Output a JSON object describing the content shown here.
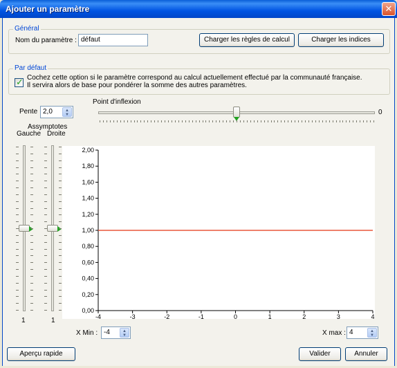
{
  "window": {
    "title": "Ajouter un paramètre",
    "close_glyph": "✕"
  },
  "general": {
    "legend": "Général",
    "name_label": "Nom du paramètre :",
    "name_value": "défaut",
    "load_rules_label": "Charger les règles de calcul",
    "load_indices_label": "Charger les indices"
  },
  "default_group": {
    "legend": "Par défaut",
    "checkbox_checked": true,
    "checkbox_text_line1": "Cochez cette option si le paramètre correspond au calcul actuellement effectué par la communauté française.",
    "checkbox_text_line2": "Il servira alors de base pour pondérer la somme des autres paramètres."
  },
  "pente": {
    "label": "Pente",
    "value": "2,0"
  },
  "inflexion": {
    "label": "Point d'inflexion",
    "value_label": "0",
    "slider_fraction": 0.5
  },
  "asymptotes": {
    "title": "Assymptotes",
    "left_label": "Gauche",
    "right_label": "Droite",
    "left_value": "1",
    "right_value": "1",
    "left_slider_fraction": 0.5,
    "right_slider_fraction": 0.5
  },
  "range": {
    "xmin_label": "X Min :",
    "xmin_value": "-4",
    "xmax_label": "X max :",
    "xmax_value": "4"
  },
  "buttons": {
    "preview_label": "Aperçu rapide",
    "validate_label": "Valider",
    "cancel_label": "Annuler"
  },
  "colors": {
    "series_line": "#e8563a",
    "legend_blue": "#0046d5",
    "title_bar": "#0054e3"
  },
  "chart_data": {
    "type": "line",
    "x": [
      -4,
      -3,
      -2,
      -1,
      0,
      1,
      2,
      3,
      4
    ],
    "series": [
      {
        "values": [
          1.0,
          1.0,
          1.0,
          1.0,
          1.0,
          1.0,
          1.0,
          1.0,
          1.0
        ]
      }
    ],
    "xticks": [
      "-4",
      "-3",
      "-2",
      "-1",
      "0",
      "1",
      "2",
      "3",
      "4"
    ],
    "yticks": [
      "0,00",
      "0,20",
      "0,40",
      "0,60",
      "0,80",
      "1,00",
      "1,20",
      "1,40",
      "1,60",
      "1,80",
      "2,00"
    ],
    "xlim": [
      -4,
      4
    ],
    "ylim": [
      0,
      2
    ],
    "grid": false
  }
}
